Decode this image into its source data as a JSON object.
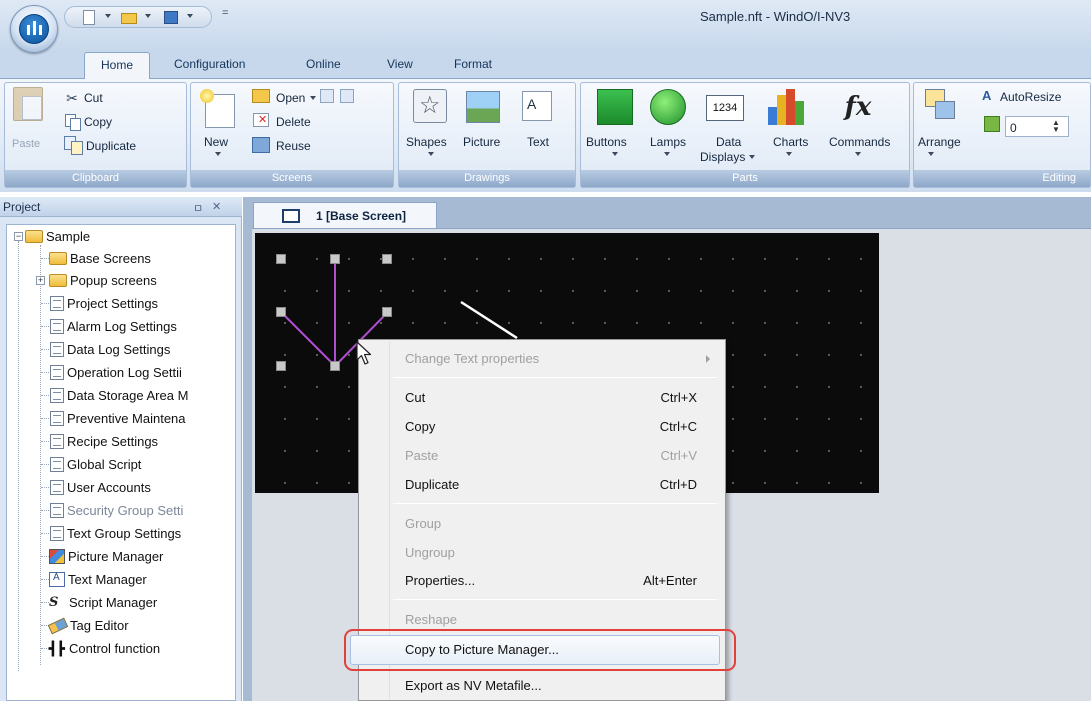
{
  "window": {
    "title": "Sample.nft - WindO/I-NV3",
    "qat_more": "="
  },
  "menu_tabs": [
    "Home",
    "Configuration",
    "Online",
    "View",
    "Format"
  ],
  "ribbon": {
    "clipboard": {
      "label": "Clipboard",
      "paste": "Paste",
      "cut": "Cut",
      "copy": "Copy",
      "duplicate": "Duplicate"
    },
    "screens": {
      "label": "Screens",
      "new": "New",
      "open": "Open",
      "delete": "Delete",
      "reuse": "Reuse"
    },
    "drawings": {
      "label": "Drawings",
      "shapes": "Shapes",
      "picture": "Picture",
      "text": "Text"
    },
    "parts": {
      "label": "Parts",
      "buttons": "Buttons",
      "lamps": "Lamps",
      "data_displays_1": "Data",
      "data_displays_2": "Displays",
      "data_icon": "1234",
      "charts": "Charts",
      "commands": "Commands",
      "commands_icon": "fx"
    },
    "editing": {
      "label": "Editing",
      "arrange": "Arrange",
      "autoresize": "AutoResize",
      "spin_value": "0"
    }
  },
  "project_pane": {
    "title": "Project",
    "pin": "ㅁ",
    "close": "✕",
    "tree": [
      "Sample",
      "Base Screens",
      "Popup screens",
      "Project Settings",
      "Alarm Log Settings",
      "Data Log Settings",
      "Operation Log Settii",
      "Data Storage Area M",
      "Preventive Maintena",
      "Recipe Settings",
      "Global Script",
      "User Accounts",
      "Security Group Setti",
      "Text Group Settings",
      "Picture Manager",
      "Text Manager",
      "Script Manager",
      "Tag Editor",
      "Control function"
    ]
  },
  "doc_tab": {
    "label": "1  [Base Screen]"
  },
  "context_menu": {
    "change_text": "Change Text properties",
    "cut": "Cut",
    "cut_sc": "Ctrl+X",
    "copy": "Copy",
    "copy_sc": "Ctrl+C",
    "paste": "Paste",
    "paste_sc": "Ctrl+V",
    "duplicate": "Duplicate",
    "duplicate_sc": "Ctrl+D",
    "group": "Group",
    "ungroup": "Ungroup",
    "properties": "Properties...",
    "properties_sc": "Alt+Enter",
    "reshape": "Reshape",
    "copy_to_picture": "Copy to Picture Manager...",
    "export_metafile": "Export as NV Metafile..."
  },
  "colors": {
    "accent_highlight": "#e2403a",
    "canvas": "#0b0b0b",
    "ribbon_blue": "#c7d8ec"
  }
}
